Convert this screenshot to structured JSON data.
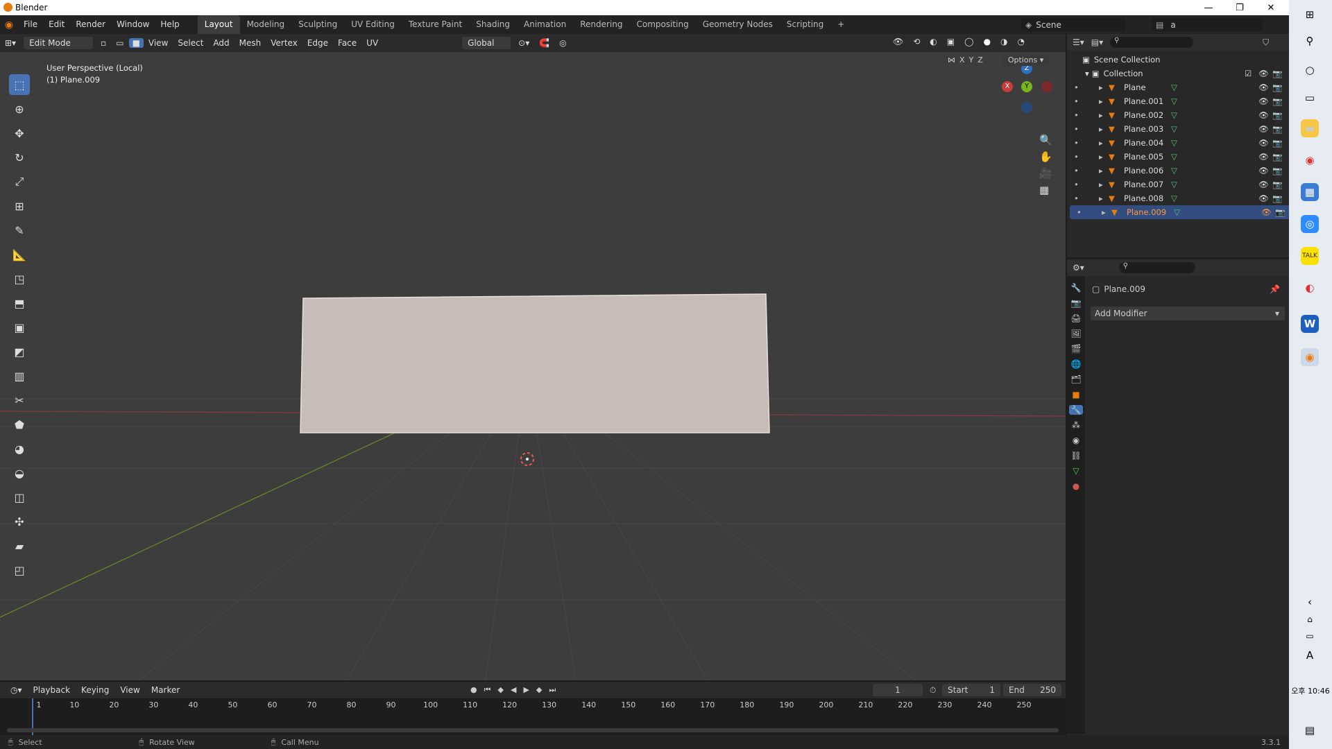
{
  "window": {
    "title": "Blender"
  },
  "menus": [
    "File",
    "Edit",
    "Render",
    "Window",
    "Help"
  ],
  "workspaces": [
    "Layout",
    "Modeling",
    "Sculpting",
    "UV Editing",
    "Texture Paint",
    "Shading",
    "Animation",
    "Rendering",
    "Compositing",
    "Geometry Nodes",
    "Scripting"
  ],
  "active_workspace": "Layout",
  "scene": {
    "label": "Scene",
    "view_layer": "a"
  },
  "viewport_header": {
    "mode": "Edit Mode",
    "menus": [
      "View",
      "Select",
      "Add",
      "Mesh",
      "Vertex",
      "Edge",
      "Face",
      "UV"
    ],
    "transform_orientation": "Global",
    "axes": [
      "X",
      "Y",
      "Z"
    ],
    "options_label": "Options"
  },
  "viewport": {
    "perspective_text": "User Perspective (Local)",
    "object_text": "(1) Plane.009",
    "gizmo": {
      "z": "Z",
      "y": "Y",
      "x": "X"
    }
  },
  "outliner": {
    "scene_collection": "Scene Collection",
    "collection": "Collection",
    "items": [
      "Plane",
      "Plane.001",
      "Plane.002",
      "Plane.003",
      "Plane.004",
      "Plane.005",
      "Plane.006",
      "Plane.007",
      "Plane.008",
      "Plane.009"
    ],
    "selected": "Plane.009"
  },
  "properties": {
    "object_name": "Plane.009",
    "add_modifier_label": "Add Modifier"
  },
  "timeline": {
    "menus": [
      "Playback",
      "Keying",
      "View",
      "Marker"
    ],
    "current_frame": "1",
    "start_label": "Start",
    "start_value": "1",
    "end_label": "End",
    "end_value": "250",
    "ticks": [
      "1",
      "10",
      "20",
      "30",
      "40",
      "50",
      "60",
      "70",
      "80",
      "90",
      "100",
      "110",
      "120",
      "130",
      "140",
      "150",
      "160",
      "170",
      "180",
      "190",
      "200",
      "210",
      "220",
      "230",
      "240",
      "250"
    ]
  },
  "statusbar": {
    "select": "Select",
    "rotate_view": "Rotate View",
    "call_menu": "Call Menu",
    "version": "3.3.1"
  },
  "taskbar": {
    "clock": "오후 10:46",
    "ime": "A"
  },
  "colors": {
    "accent": "#4772b3",
    "selected_text": "#ff9b3d",
    "plane_fill": "#c8bcb8"
  }
}
